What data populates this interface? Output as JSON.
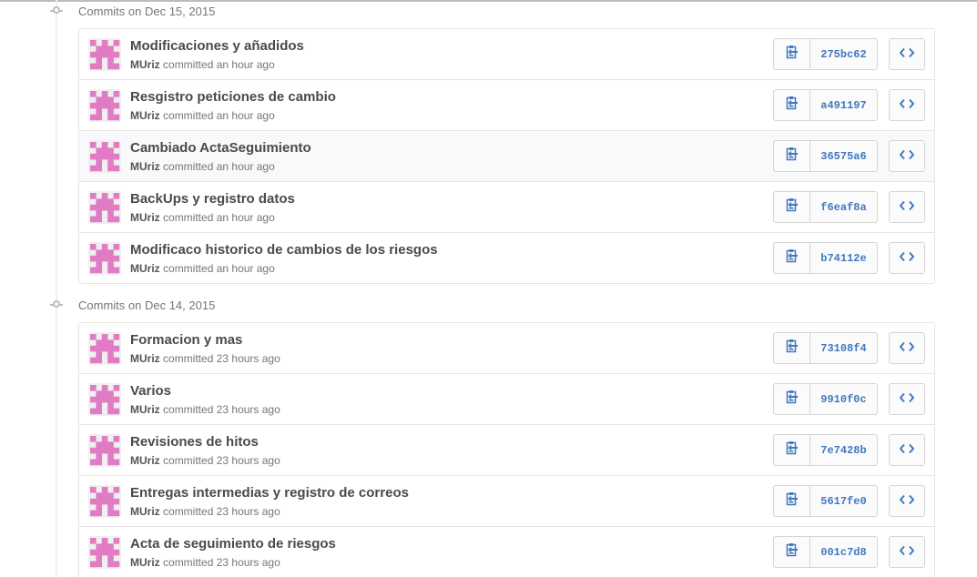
{
  "groups": [
    {
      "label": "Commits on Dec 15, 2015",
      "commits": [
        {
          "message": "Modificaciones y añadidos",
          "author": "MUriz",
          "action": "committed",
          "time": "an hour ago",
          "sha": "275bc62"
        },
        {
          "message": "Resgistro peticiones de cambio",
          "author": "MUriz",
          "action": "committed",
          "time": "an hour ago",
          "sha": "a491197"
        },
        {
          "message": "Cambiado ActaSeguimiento",
          "author": "MUriz",
          "action": "committed",
          "time": "an hour ago",
          "sha": "36575a6"
        },
        {
          "message": "BackUps y registro datos",
          "author": "MUriz",
          "action": "committed",
          "time": "an hour ago",
          "sha": "f6eaf8a"
        },
        {
          "message": "Modificaco historico de cambios de los riesgos",
          "author": "MUriz",
          "action": "committed",
          "time": "an hour ago",
          "sha": "b74112e"
        }
      ]
    },
    {
      "label": "Commits on Dec 14, 2015",
      "commits": [
        {
          "message": "Formacion y mas",
          "author": "MUriz",
          "action": "committed",
          "time": "23 hours ago",
          "sha": "73108f4"
        },
        {
          "message": "Varios",
          "author": "MUriz",
          "action": "committed",
          "time": "23 hours ago",
          "sha": "9910f0c"
        },
        {
          "message": "Revisiones de hitos",
          "author": "MUriz",
          "action": "committed",
          "time": "23 hours ago",
          "sha": "7e7428b"
        },
        {
          "message": "Entregas intermedias y registro de correos",
          "author": "MUriz",
          "action": "committed",
          "time": "23 hours ago",
          "sha": "5617fe0"
        },
        {
          "message": "Acta de seguimiento de riesgos",
          "author": "MUriz",
          "action": "committed",
          "time": "23 hours ago",
          "sha": "001c7d8"
        }
      ]
    }
  ],
  "icons": {
    "copy": "clipboard-icon",
    "browse": "code-icon",
    "avatar": "identicon"
  },
  "colors": {
    "identicon": "#e07bc4",
    "sha_link": "#4078c0"
  }
}
